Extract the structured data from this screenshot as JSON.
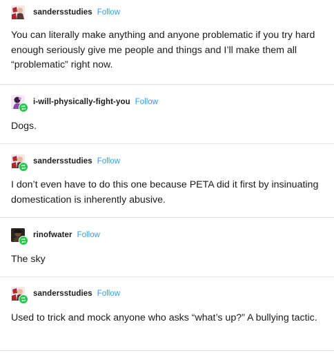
{
  "posts": [
    {
      "username": "sandersstudies",
      "follow_label": "Follow",
      "avatar_icon": "user-avatar-icon",
      "reblog_badge": false,
      "text": "You can literally make anything and anyone problematic if you try hard enough seriously give me people and things and I’ll make them all “problematic” right now."
    },
    {
      "username": "i-will-physically-fight-you",
      "follow_label": "Follow",
      "avatar_icon": "user-avatar-icon",
      "reblog_badge": true,
      "text": "Dogs."
    },
    {
      "username": "sandersstudies",
      "follow_label": "Follow",
      "avatar_icon": "user-avatar-icon",
      "reblog_badge": true,
      "text": "I don’t even have to do this one because PETA did it first by insinuating domestication is inherently abusive."
    },
    {
      "username": "rinofwater",
      "follow_label": "Follow",
      "avatar_icon": "user-avatar-icon",
      "reblog_badge": true,
      "text": "The sky"
    },
    {
      "username": "sandersstudies",
      "follow_label": "Follow",
      "avatar_icon": "user-avatar-icon",
      "reblog_badge": true,
      "text": "Used to trick and mock anyone who asks “what’s up?” A bullying tactic."
    }
  ],
  "colors": {
    "follow_link": "#2f9be6",
    "reblog_badge": "#1ec94a",
    "divider": "#e4e4e4",
    "text": "#1a1a1a"
  }
}
